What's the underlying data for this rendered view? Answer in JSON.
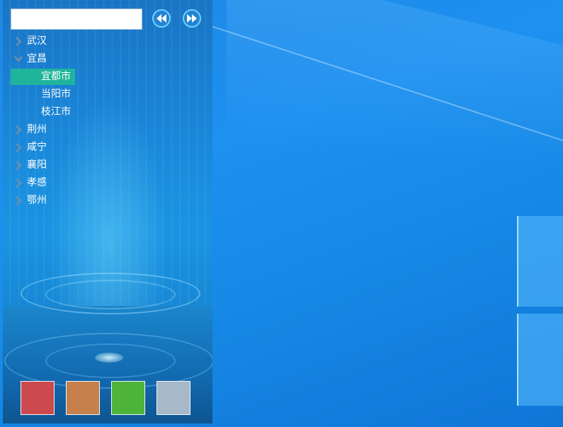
{
  "search": {
    "placeholder": "",
    "value": ""
  },
  "nav": {
    "prev_icon": "rewind-icon",
    "next_icon": "fast-forward-icon"
  },
  "tree": {
    "nodes": [
      {
        "label": "武汉",
        "expanded": false
      },
      {
        "label": "宜昌",
        "expanded": true,
        "children": [
          {
            "label": "宜都市",
            "selected": true
          },
          {
            "label": "当阳市",
            "selected": false
          },
          {
            "label": "枝江市",
            "selected": false
          }
        ]
      },
      {
        "label": "荆州",
        "expanded": false
      },
      {
        "label": "咸宁",
        "expanded": false
      },
      {
        "label": "襄阳",
        "expanded": false
      },
      {
        "label": "孝感",
        "expanded": false
      },
      {
        "label": "鄂州",
        "expanded": false
      }
    ]
  },
  "theme_swatches": [
    "#cc4a4e",
    "#c6804c",
    "#4db33b",
    "#a7b8c8"
  ],
  "colors": {
    "selected_bg": "#1fb59a",
    "arrow": "#6f8fa8",
    "nav_ring": "#6fd0ff"
  }
}
